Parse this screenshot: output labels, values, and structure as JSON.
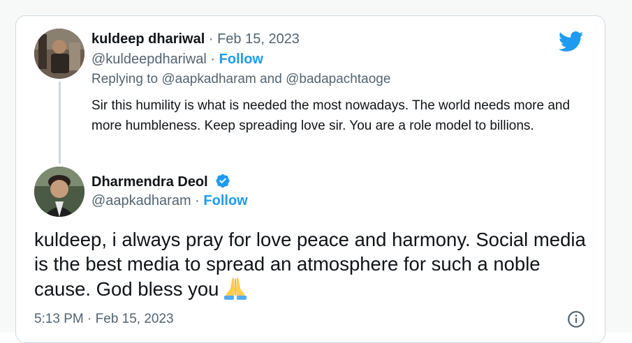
{
  "quoted_tweet": {
    "author_name": "kuldeep dhariwal",
    "date": "Feb 15, 2023",
    "handle": "@kuldeepdhariwal",
    "follow_label": "Follow",
    "replying_prefix": "Replying to",
    "replying_to_1": "@aapkadharam",
    "replying_and": "and",
    "replying_to_2": "@badapachtaoge",
    "text": "Sir this humility is what is needed the most nowadays. The world needs more and more humbleness. Keep spreading love sir. You are a role model to billions."
  },
  "main_tweet": {
    "author_name": "Dharmendra Deol",
    "verified": true,
    "handle": "@aapkadharam",
    "follow_label": "Follow",
    "text": "kuldeep, i always pray for love peace and harmony. Social media is the best media to spread an atmosphere for such a noble cause. God bless you",
    "emoji": "folded-hands",
    "timestamp": "5:13 PM · Feb 15, 2023"
  },
  "separator": "·",
  "icons": {
    "brand": "twitter-bird-icon",
    "info": "info-icon",
    "verified": "verified-badge-icon"
  },
  "colors": {
    "brand_blue": "#1d9bf0",
    "text_primary": "#0f1419",
    "text_secondary": "#536471",
    "border": "#cfd9de"
  }
}
